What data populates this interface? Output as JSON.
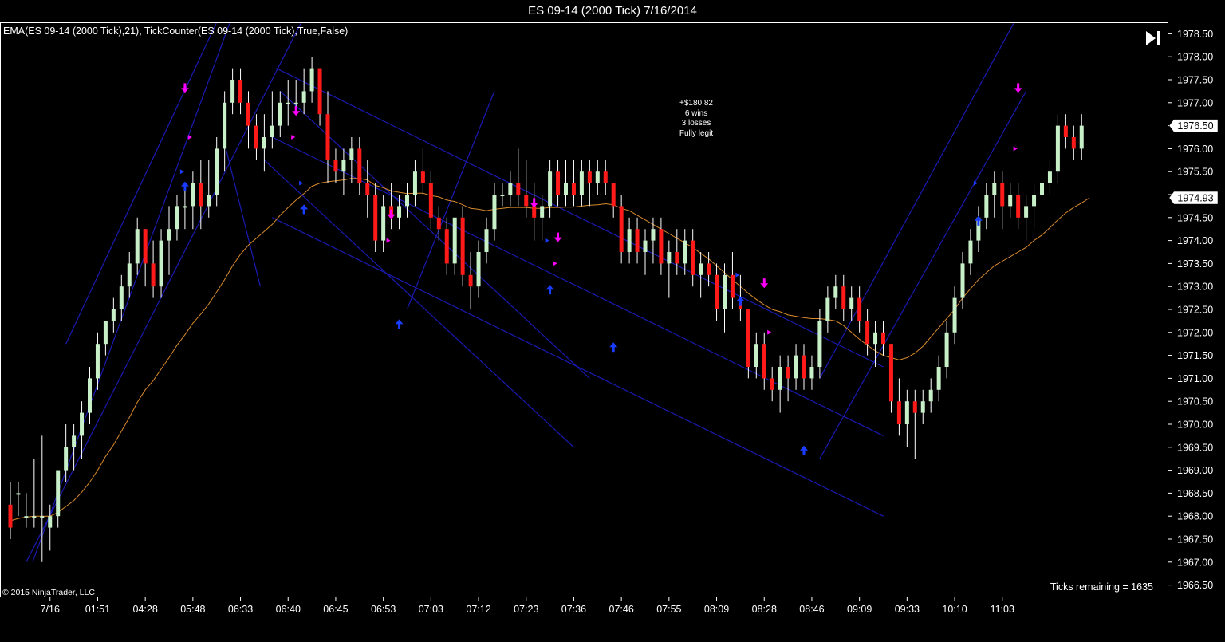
{
  "window": {
    "title": "ES 09-14 (2000 Tick)  7/16/2014"
  },
  "indicators_text": "EMA(ES 09-14 (2000 Tick),21),  TickCounter(ES 09-14 (2000 Tick),True,False)",
  "copyright": "© 2015 NinjaTrader, LLC",
  "ticks_remaining": "Ticks remaining = 1635",
  "stats": {
    "line1": "+$180.82",
    "line2": "6 wins",
    "line3": "3 losses",
    "line4": "Fully legit"
  },
  "controls": {
    "play_icon": "skip-to-end-icon"
  },
  "colors": {
    "background": "#000000",
    "up_candle": "#c8f0c8",
    "down_candle": "#ff1a1a",
    "ema": "#d98a2b",
    "trendline": "#1a1ab4",
    "sell_arrow": "#ff00ff",
    "buy_arrow": "#1a3cff"
  },
  "chart_data": {
    "type": "candlestick",
    "ylim": [
      1966.25,
      1978.75
    ],
    "y_ticks": [
      "1966.50",
      "1967.00",
      "1967.50",
      "1968.00",
      "1968.50",
      "1969.00",
      "1969.50",
      "1970.00",
      "1970.50",
      "1971.00",
      "1971.50",
      "1972.00",
      "1972.50",
      "1973.00",
      "1973.50",
      "1974.00",
      "1974.50",
      "1975.00",
      "1975.50",
      "1976.00",
      "1976.50",
      "1977.00",
      "1977.50",
      "1978.00",
      "1978.50"
    ],
    "x_tick_labels": [
      {
        "label": "7/16",
        "bar": 5
      },
      {
        "label": "01:51",
        "bar": 11
      },
      {
        "label": "04:28",
        "bar": 17
      },
      {
        "label": "05:48",
        "bar": 23
      },
      {
        "label": "06:33",
        "bar": 29
      },
      {
        "label": "06:40",
        "bar": 35
      },
      {
        "label": "06:45",
        "bar": 41
      },
      {
        "label": "06:53",
        "bar": 47
      },
      {
        "label": "07:03",
        "bar": 53
      },
      {
        "label": "07:12",
        "bar": 59
      },
      {
        "label": "07:23",
        "bar": 65
      },
      {
        "label": "07:36",
        "bar": 71
      },
      {
        "label": "07:46",
        "bar": 77
      },
      {
        "label": "07:55",
        "bar": 83
      },
      {
        "label": "08:09",
        "bar": 89
      },
      {
        "label": "08:28",
        "bar": 95
      },
      {
        "label": "08:46",
        "bar": 101
      },
      {
        "label": "09:09",
        "bar": 107
      },
      {
        "label": "09:33",
        "bar": 113
      },
      {
        "label": "10:10",
        "bar": 119
      },
      {
        "label": "11:03",
        "bar": 125
      }
    ],
    "price_markers": [
      {
        "label": "1976.50",
        "value": 1976.5
      },
      {
        "label": "1974.93",
        "value": 1974.93
      }
    ],
    "bars": [
      [
        1968.25,
        1968.75,
        1967.5,
        1967.75
      ],
      [
        1968.5,
        1968.75,
        1968.0,
        1968.5
      ],
      [
        1968.0,
        1968.5,
        1967.75,
        1968.0
      ],
      [
        1968.0,
        1969.25,
        1967.75,
        1968.0
      ],
      [
        1968.0,
        1969.75,
        1967.0,
        1968.0
      ],
      [
        1967.75,
        1968.25,
        1967.25,
        1968.0
      ],
      [
        1968.0,
        1969.0,
        1967.75,
        1969.0
      ],
      [
        1969.0,
        1970.0,
        1968.75,
        1969.5
      ],
      [
        1969.5,
        1970.0,
        1969.0,
        1969.75
      ],
      [
        1969.75,
        1970.5,
        1969.25,
        1970.25
      ],
      [
        1970.25,
        1971.25,
        1970.0,
        1971.0
      ],
      [
        1971.0,
        1972.0,
        1970.75,
        1971.75
      ],
      [
        1971.75,
        1972.25,
        1971.5,
        1972.25
      ],
      [
        1972.25,
        1972.75,
        1972.0,
        1972.5
      ],
      [
        1972.5,
        1973.25,
        1972.25,
        1973.0
      ],
      [
        1973.0,
        1973.75,
        1972.75,
        1973.5
      ],
      [
        1973.5,
        1974.5,
        1973.25,
        1974.25
      ],
      [
        1974.25,
        1974.25,
        1973.0,
        1973.5
      ],
      [
        1973.5,
        1974.0,
        1972.75,
        1973.0
      ],
      [
        1973.0,
        1974.25,
        1972.75,
        1974.0
      ],
      [
        1974.0,
        1974.75,
        1973.25,
        1974.25
      ],
      [
        1974.25,
        1975.0,
        1974.0,
        1974.75
      ],
      [
        1974.75,
        1975.25,
        1974.25,
        1974.75
      ],
      [
        1974.75,
        1975.5,
        1974.25,
        1975.25
      ],
      [
        1975.25,
        1975.75,
        1974.25,
        1974.75
      ],
      [
        1974.75,
        1975.75,
        1974.5,
        1975.0
      ],
      [
        1975.0,
        1976.25,
        1974.75,
        1976.0
      ],
      [
        1976.0,
        1977.25,
        1975.5,
        1977.0
      ],
      [
        1977.0,
        1977.75,
        1976.75,
        1977.5
      ],
      [
        1977.5,
        1977.75,
        1976.75,
        1977.0
      ],
      [
        1977.0,
        1977.25,
        1976.0,
        1976.5
      ],
      [
        1976.5,
        1976.75,
        1975.75,
        1976.0
      ],
      [
        1976.0,
        1976.75,
        1975.5,
        1976.25
      ],
      [
        1976.25,
        1977.25,
        1976.0,
        1976.5
      ],
      [
        1976.5,
        1977.25,
        1976.25,
        1977.0
      ],
      [
        1977.0,
        1977.5,
        1976.5,
        1977.0
      ],
      [
        1977.0,
        1977.5,
        1976.75,
        1977.0
      ],
      [
        1977.0,
        1977.75,
        1976.75,
        1977.25
      ],
      [
        1977.25,
        1978.0,
        1977.0,
        1977.75
      ],
      [
        1977.75,
        1977.75,
        1976.5,
        1976.75
      ],
      [
        1976.75,
        1977.25,
        1975.25,
        1975.75
      ],
      [
        1975.75,
        1976.0,
        1975.25,
        1975.5
      ],
      [
        1975.5,
        1976.0,
        1975.0,
        1975.75
      ],
      [
        1975.75,
        1976.25,
        1975.25,
        1976.0
      ],
      [
        1976.0,
        1976.25,
        1975.0,
        1975.25
      ],
      [
        1975.25,
        1975.75,
        1974.5,
        1975.0
      ],
      [
        1975.0,
        1975.25,
        1973.75,
        1974.0
      ],
      [
        1974.0,
        1975.0,
        1973.75,
        1974.75
      ],
      [
        1974.75,
        1975.25,
        1974.25,
        1974.5
      ],
      [
        1974.5,
        1975.0,
        1974.25,
        1974.75
      ],
      [
        1974.75,
        1975.25,
        1974.5,
        1975.0
      ],
      [
        1975.0,
        1975.75,
        1974.75,
        1975.5
      ],
      [
        1975.5,
        1976.0,
        1975.0,
        1975.25
      ],
      [
        1975.25,
        1975.5,
        1974.25,
        1974.5
      ],
      [
        1974.5,
        1974.75,
        1974.0,
        1974.25
      ],
      [
        1974.25,
        1974.5,
        1973.25,
        1973.5
      ],
      [
        1973.5,
        1974.5,
        1973.25,
        1974.5
      ],
      [
        1974.5,
        1974.75,
        1973.0,
        1973.25
      ],
      [
        1973.25,
        1973.75,
        1972.5,
        1973.0
      ],
      [
        1973.0,
        1974.0,
        1972.75,
        1973.75
      ],
      [
        1973.75,
        1974.5,
        1973.5,
        1974.25
      ],
      [
        1974.25,
        1975.25,
        1974.0,
        1975.0
      ],
      [
        1975.0,
        1975.25,
        1974.75,
        1975.0
      ],
      [
        1975.0,
        1975.5,
        1974.75,
        1975.25
      ],
      [
        1975.25,
        1976.0,
        1974.75,
        1975.0
      ],
      [
        1975.0,
        1975.75,
        1974.5,
        1974.75
      ],
      [
        1974.75,
        1975.25,
        1974.0,
        1974.5
      ],
      [
        1974.5,
        1975.0,
        1974.0,
        1974.75
      ],
      [
        1974.75,
        1975.75,
        1974.5,
        1975.5
      ],
      [
        1975.5,
        1975.75,
        1974.75,
        1975.0
      ],
      [
        1975.0,
        1975.75,
        1974.75,
        1975.25
      ],
      [
        1975.25,
        1975.75,
        1974.75,
        1975.0
      ],
      [
        1975.0,
        1975.75,
        1974.75,
        1975.5
      ],
      [
        1975.5,
        1975.75,
        1974.75,
        1975.25
      ],
      [
        1975.25,
        1975.75,
        1975.0,
        1975.5
      ],
      [
        1975.5,
        1975.75,
        1975.0,
        1975.25
      ],
      [
        1975.25,
        1975.25,
        1974.5,
        1974.75
      ],
      [
        1974.75,
        1975.0,
        1973.5,
        1973.75
      ],
      [
        1973.75,
        1974.5,
        1973.5,
        1974.25
      ],
      [
        1974.25,
        1974.5,
        1973.5,
        1973.75
      ],
      [
        1973.75,
        1974.25,
        1973.25,
        1974.0
      ],
      [
        1974.0,
        1974.5,
        1973.5,
        1974.25
      ],
      [
        1974.25,
        1974.5,
        1973.25,
        1973.5
      ],
      [
        1973.5,
        1974.0,
        1972.75,
        1973.75
      ],
      [
        1973.75,
        1974.25,
        1973.25,
        1973.5
      ],
      [
        1973.5,
        1974.25,
        1973.25,
        1974.0
      ],
      [
        1974.0,
        1974.25,
        1973.0,
        1973.25
      ],
      [
        1973.25,
        1973.75,
        1972.75,
        1973.5
      ],
      [
        1973.5,
        1973.75,
        1973.0,
        1973.25
      ],
      [
        1973.25,
        1973.5,
        1972.25,
        1972.5
      ],
      [
        1972.5,
        1973.5,
        1972.0,
        1973.25
      ],
      [
        1973.25,
        1973.75,
        1972.5,
        1972.75
      ],
      [
        1972.75,
        1973.25,
        1972.25,
        1972.5
      ],
      [
        1972.5,
        1972.5,
        1971.0,
        1971.25
      ],
      [
        1971.25,
        1972.0,
        1971.0,
        1971.75
      ],
      [
        1971.75,
        1972.0,
        1970.75,
        1971.0
      ],
      [
        1971.0,
        1971.25,
        1970.5,
        1970.75
      ],
      [
        1970.75,
        1971.5,
        1970.25,
        1971.25
      ],
      [
        1971.25,
        1971.5,
        1970.5,
        1971.0
      ],
      [
        1971.0,
        1971.75,
        1970.75,
        1971.5
      ],
      [
        1971.5,
        1971.75,
        1970.75,
        1971.0
      ],
      [
        1971.0,
        1971.5,
        1970.75,
        1971.25
      ],
      [
        1971.25,
        1972.5,
        1971.0,
        1972.25
      ],
      [
        1972.25,
        1973.0,
        1972.0,
        1972.75
      ],
      [
        1972.75,
        1973.25,
        1972.5,
        1973.0
      ],
      [
        1973.0,
        1973.25,
        1972.25,
        1972.5
      ],
      [
        1972.5,
        1973.0,
        1972.25,
        1972.75
      ],
      [
        1972.75,
        1973.0,
        1972.0,
        1972.25
      ],
      [
        1972.25,
        1972.5,
        1971.5,
        1971.75
      ],
      [
        1971.75,
        1972.25,
        1971.25,
        1972.0
      ],
      [
        1972.0,
        1972.25,
        1971.5,
        1971.75
      ],
      [
        1971.75,
        1971.75,
        1970.25,
        1970.5
      ],
      [
        1970.5,
        1971.0,
        1969.75,
        1970.0
      ],
      [
        1970.0,
        1970.75,
        1969.5,
        1970.5
      ],
      [
        1970.5,
        1970.75,
        1969.25,
        1970.25
      ],
      [
        1970.25,
        1970.75,
        1970.0,
        1970.5
      ],
      [
        1970.5,
        1971.0,
        1970.25,
        1970.75
      ],
      [
        1970.75,
        1971.5,
        1970.5,
        1971.25
      ],
      [
        1971.25,
        1972.25,
        1971.0,
        1972.0
      ],
      [
        1972.0,
        1973.0,
        1971.75,
        1972.75
      ],
      [
        1972.75,
        1973.75,
        1972.5,
        1973.5
      ],
      [
        1973.5,
        1974.25,
        1973.25,
        1974.0
      ],
      [
        1974.0,
        1974.75,
        1973.75,
        1974.5
      ],
      [
        1974.5,
        1975.25,
        1974.25,
        1975.0
      ],
      [
        1975.0,
        1975.5,
        1974.5,
        1975.25
      ],
      [
        1975.25,
        1975.5,
        1974.25,
        1974.75
      ],
      [
        1974.75,
        1975.25,
        1974.5,
        1975.0
      ],
      [
        1975.0,
        1975.25,
        1974.25,
        1974.5
      ],
      [
        1974.5,
        1975.0,
        1974.0,
        1974.75
      ],
      [
        1974.75,
        1975.25,
        1974.25,
        1975.0
      ],
      [
        1975.0,
        1975.5,
        1974.5,
        1975.25
      ],
      [
        1975.25,
        1975.75,
        1975.0,
        1975.5
      ],
      [
        1975.5,
        1976.75,
        1975.25,
        1976.5
      ],
      [
        1976.5,
        1976.75,
        1976.0,
        1976.25
      ],
      [
        1976.25,
        1976.5,
        1975.75,
        1976.0
      ],
      [
        1976.0,
        1976.75,
        1975.75,
        1976.5
      ]
    ],
    "ema": [
      1967.9,
      1967.95,
      1967.98,
      1968.0,
      1968.0,
      1968.0,
      1968.08,
      1968.21,
      1968.34,
      1968.52,
      1968.74,
      1969.0,
      1969.3,
      1969.55,
      1969.85,
      1970.15,
      1970.48,
      1970.75,
      1970.95,
      1971.2,
      1971.45,
      1971.72,
      1971.95,
      1972.2,
      1972.4,
      1972.62,
      1972.88,
      1973.15,
      1973.45,
      1973.7,
      1973.9,
      1974.05,
      1974.2,
      1974.35,
      1974.55,
      1974.72,
      1974.88,
      1975.02,
      1975.18,
      1975.25,
      1975.28,
      1975.3,
      1975.32,
      1975.35,
      1975.35,
      1975.32,
      1975.2,
      1975.15,
      1975.08,
      1975.05,
      1975.02,
      1975.03,
      1975.03,
      1974.98,
      1974.95,
      1974.88,
      1974.85,
      1974.78,
      1974.7,
      1974.68,
      1974.65,
      1974.68,
      1974.7,
      1974.72,
      1974.72,
      1974.72,
      1974.7,
      1974.7,
      1974.72,
      1974.72,
      1974.73,
      1974.73,
      1974.75,
      1974.77,
      1974.78,
      1974.8,
      1974.78,
      1974.7,
      1974.65,
      1974.55,
      1974.45,
      1974.35,
      1974.25,
      1974.15,
      1974.05,
      1973.95,
      1973.85,
      1973.72,
      1973.6,
      1973.45,
      1973.3,
      1973.15,
      1973.0,
      1972.85,
      1972.72,
      1972.6,
      1972.5,
      1972.45,
      1972.38,
      1972.35,
      1972.32,
      1972.3,
      1972.3,
      1972.28,
      1972.25,
      1972.15,
      1972.0,
      1971.85,
      1971.72,
      1971.6,
      1971.5,
      1971.45,
      1971.4,
      1971.45,
      1971.55,
      1971.7,
      1971.9,
      1972.1,
      1972.3,
      1972.5,
      1972.75,
      1972.95,
      1973.15,
      1973.3,
      1973.45,
      1973.55,
      1973.65,
      1973.75,
      1973.85,
      1974.0,
      1974.12,
      1974.28,
      1974.45,
      1974.6,
      1974.72,
      1974.82,
      1974.93
    ],
    "sell_signals": [
      {
        "bar": 22,
        "price": 1977.25
      },
      {
        "bar": 36,
        "price": 1976.75
      },
      {
        "bar": 48,
        "price": 1974.5
      },
      {
        "bar": 66,
        "price": 1974.75
      },
      {
        "bar": 69,
        "price": 1974.0
      },
      {
        "bar": 95,
        "price": 1973.0
      },
      {
        "bar": 127,
        "price": 1977.25
      }
    ],
    "buy_signals": [
      {
        "bar": 22,
        "price": 1975.25
      },
      {
        "bar": 37,
        "price": 1974.75
      },
      {
        "bar": 49,
        "price": 1972.25
      },
      {
        "bar": 68,
        "price": 1973.0
      },
      {
        "bar": 76,
        "price": 1971.75
      },
      {
        "bar": 92,
        "price": 1972.75
      },
      {
        "bar": 100,
        "price": 1969.5
      },
      {
        "bar": 122,
        "price": 1974.5
      }
    ],
    "exit_markers": [
      {
        "bar": 23,
        "price": 1976.25,
        "color": "#ff00ff"
      },
      {
        "bar": 36,
        "price": 1976.25,
        "color": "#ff00ff"
      },
      {
        "bar": 48,
        "price": 1974.0,
        "color": "#ff00ff"
      },
      {
        "bar": 69,
        "price": 1973.5,
        "color": "#ff00ff"
      },
      {
        "bar": 96,
        "price": 1972.0,
        "color": "#ff00ff"
      },
      {
        "bar": 127,
        "price": 1976.0,
        "color": "#ff00ff"
      },
      {
        "bar": 22,
        "price": 1975.5,
        "color": "#1a3cff"
      },
      {
        "bar": 37,
        "price": 1975.25,
        "color": "#1a3cff"
      },
      {
        "bar": 68,
        "price": 1974.0,
        "color": "#1a3cff"
      },
      {
        "bar": 92,
        "price": 1973.25,
        "color": "#1a3cff"
      },
      {
        "bar": 122,
        "price": 1975.25,
        "color": "#1a3cff"
      }
    ],
    "trendlines": [
      {
        "b1": 2.8,
        "p1": 1967.0,
        "b2": 28.2,
        "p2": 1979.0
      },
      {
        "b1": 7,
        "p1": 1971.75,
        "b2": 26,
        "p2": 1978.75
      },
      {
        "b1": 2,
        "p1": 1967.0,
        "b2": 37.4,
        "p2": 1979.0
      },
      {
        "b1": 26.8,
        "p1": 1976.25,
        "b2": 31.5,
        "p2": 1973.0
      },
      {
        "b1": 33.5,
        "p1": 1977.75,
        "b2": 110,
        "p2": 1971.25
      },
      {
        "b1": 33,
        "p1": 1976.25,
        "b2": 110,
        "p2": 1969.75
      },
      {
        "b1": 33,
        "p1": 1974.5,
        "b2": 110,
        "p2": 1968.0
      },
      {
        "b1": 32,
        "p1": 1975.75,
        "b2": 71,
        "p2": 1969.5
      },
      {
        "b1": 34,
        "p1": 1977.25,
        "b2": 73,
        "p2": 1971.0
      },
      {
        "b1": 50,
        "p1": 1972.5,
        "b2": 61,
        "p2": 1977.25
      },
      {
        "b1": 102,
        "p1": 1969.25,
        "b2": 128,
        "p2": 1977.25
      },
      {
        "b1": 102,
        "p1": 1971.0,
        "b2": 126.5,
        "p2": 1978.75
      }
    ]
  }
}
